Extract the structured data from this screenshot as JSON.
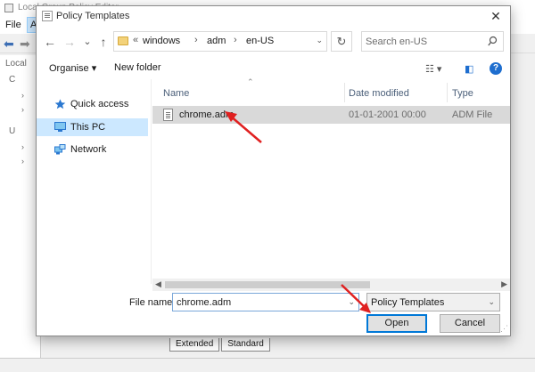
{
  "background_window": {
    "title": "Local Group Policy Editor",
    "menu": [
      "File",
      "A"
    ],
    "tree_items": [
      "Local",
      "C",
      "U"
    ],
    "tabs": [
      "Extended",
      "Standard"
    ]
  },
  "dialog": {
    "title": "Policy Templates",
    "close_glyph": "✕",
    "nav": {
      "back_glyph": "←",
      "forward_glyph": "→",
      "recent_glyph": "⌄",
      "up_glyph": "↑"
    },
    "address": {
      "overflow": "«",
      "segments": [
        "windows",
        "adm",
        "en-US"
      ],
      "separator": "›"
    },
    "refresh_glyph": "↻",
    "search": {
      "placeholder": "Search en-US"
    },
    "toolbar": {
      "organise_label": "Organise ▾",
      "new_folder_label": "New folder",
      "help_glyph": "?"
    },
    "nav_pane": [
      {
        "label": "Quick access",
        "icon": "star-icon"
      },
      {
        "label": "This PC",
        "icon": "computer-icon",
        "selected": true
      },
      {
        "label": "Network",
        "icon": "network-icon"
      }
    ],
    "columns": {
      "name": "Name",
      "date_modified": "Date modified",
      "type": "Type"
    },
    "files": [
      {
        "name": "chrome.adm",
        "date_modified": "01-01-2001 00:00",
        "type": "ADM File"
      }
    ],
    "file_name": {
      "label": "File name:",
      "value": "chrome.adm"
    },
    "file_type": {
      "value": "Policy Templates"
    },
    "buttons": {
      "open": "Open",
      "cancel": "Cancel"
    }
  },
  "colors": {
    "selection": "#cce8ff",
    "row_highlight": "#d9d9d9",
    "folder": "#f3d27a",
    "annotation_arrow": "#e02020",
    "help_blue": "#1e6ecf"
  }
}
